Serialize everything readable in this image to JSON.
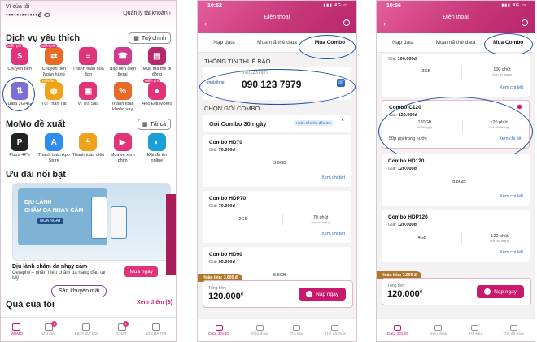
{
  "phone1": {
    "wallet_label": "Ví của tôi",
    "wallet_value": "••••••••••••đ",
    "manage_account": "Quản lý tài khoản",
    "services_title": "Dịch vụ yêu thích",
    "customize_btn": "Tuỳ chỉnh",
    "services": [
      {
        "label": "Chuyển tiền",
        "tag": "Miễn phí",
        "color": "#e0337a",
        "icon": "dollar-icon"
      },
      {
        "label": "Chuyển tiền Ngân hàng",
        "tag": "Miễn phí",
        "color": "#e86a26",
        "icon": "bank-icon"
      },
      {
        "label": "Thanh toán hóa đơn",
        "tag": "",
        "color": "#e0337a",
        "icon": "bill-icon"
      },
      {
        "label": "Nạp tiền điện thoại",
        "tag": "",
        "color": "#d03a8c",
        "icon": "phone-icon"
      },
      {
        "label": "Mua mã thẻ di động",
        "tag": "",
        "color": "#b8276c",
        "icon": "card-icon"
      },
      {
        "label": "Data 3G/4G",
        "tag": "",
        "color": "#7b6fd6",
        "icon": "data-icon"
      },
      {
        "label": "Túi Thần Tài",
        "tag": "2%/năm",
        "color": "#f0a31a",
        "icon": "bag-icon"
      },
      {
        "label": "Ví Trả Sau",
        "tag": "",
        "color": "#e0337a",
        "icon": "wallet-icon"
      },
      {
        "label": "Thanh toán khoản vay",
        "tag": "",
        "color": "#e86a26",
        "icon": "loan-icon"
      },
      {
        "label": "Heo Đất MoMo",
        "tag": "Miễn phí",
        "color": "#e0337a",
        "icon": "pig-icon"
      }
    ],
    "momo_suggest_title": "MoMo đề xuất",
    "see_all_btn": "Tất cả",
    "suggestions": [
      {
        "label": "Pizza 4P's",
        "color": "#222",
        "icon": "pizza-icon"
      },
      {
        "label": "Thanh toán App Store",
        "color": "#2d8cf0",
        "icon": "appstore-icon"
      },
      {
        "label": "Thanh toán điện",
        "color": "#f0a31a",
        "icon": "electric-icon"
      },
      {
        "label": "Mua vé xem phim",
        "color": "#e0337a",
        "icon": "ticket-icon"
      },
      {
        "label": "Đặt đồ ăn online",
        "color": "#1aa0d8",
        "icon": "food-icon"
      }
    ],
    "deals_title": "Ưu đãi nổi bật",
    "banner_line1": "DỊU LÀNH",
    "banner_line2": "CHĂM DA NHẠY CẢM",
    "banner_cta": "MUA NGAY",
    "deal_title": "Dịu lành chăm da nhạy cảm",
    "deal_sub": "Cetaphil – nhãn hiệu chăm da hàng đầu tại Mỹ",
    "buy_now": "Mua ngay",
    "promo_store": "Săn khuyến mãi",
    "gifts_title": "Quà của tôi",
    "see_more": "Xem thêm (8)",
    "nav": [
      {
        "label": "MOMO",
        "badge": ""
      },
      {
        "label": "ƯU ĐÃI",
        "badge": "8"
      },
      {
        "label": "LỊCH SỬ GD",
        "badge": ""
      },
      {
        "label": "CHAT",
        "badge": "1"
      },
      {
        "label": "VÍ CỦA TÔI",
        "badge": ""
      }
    ]
  },
  "phone2": {
    "time": "10:52",
    "signal": "4G",
    "title": "Điện thoại",
    "tabs": [
      "Nạp data",
      "Mua mã thẻ data",
      "Mua Combo"
    ],
    "subscriber_label": "THÔNG TIN THUÊ BAO",
    "carrier": "mobifone",
    "phone_small": "0901237979",
    "phone_big": "090 123 7979",
    "choose_label": "CHỌN GÓI COMBO",
    "group_name": "Gói Combo 30 ngày",
    "group_badge": "Hoàn tiền lên đến 3%",
    "combos": [
      {
        "name": "Combo HD70",
        "price_label": "Giá:",
        "price": "70.000đ",
        "data": "3.8GB",
        "minutes": "",
        "minutes_sub": ""
      },
      {
        "name": "Combo HDP70",
        "price_label": "Giá:",
        "price": "70.000đ",
        "data": "2GB",
        "minutes": "70 phút",
        "minutes_sub": "Gọi nội mạng"
      },
      {
        "name": "Combo HD90",
        "price_label": "Giá:",
        "price": "90.000đ",
        "data": "5.5GB",
        "minutes": "",
        "minutes_sub": ""
      }
    ],
    "see_detail": "Xem chi tiết",
    "cashback": "Hoàn tiền: 3.600 đ",
    "total_label": "Tổng tiền:",
    "total_value": "120.000",
    "currency": "đ",
    "pay_btn": "Nạp ngay",
    "bottom_tabs": [
      "Data 3G/4G",
      "Điện thoại",
      "Trả sau",
      "Thẻ đã mua"
    ]
  },
  "phone3": {
    "time": "10:56",
    "signal": "4G",
    "title": "Điện thoại",
    "tabs": [
      "Nạp data",
      "Mua mã thẻ data",
      "Mua Combo"
    ],
    "top_price_label": "Giá:",
    "top_price": "100.000đ",
    "top_data": "3GB",
    "top_minutes": "100 phút",
    "top_minutes_sub": "Gọi nội mạng",
    "selected": {
      "name": "Combo C120",
      "price_label": "Giá:",
      "price": "120.000đ",
      "data": "120GB",
      "data_sub": "4GB/ngày",
      "minutes": "<20 phút",
      "minutes_sub": "Gọi nội mạng",
      "extra": "50p gọi trong nước"
    },
    "combos": [
      {
        "name": "Combo HD120",
        "price_label": "Giá:",
        "price": "120.000đ",
        "data": "8.8GB",
        "minutes": "",
        "minutes_sub": ""
      },
      {
        "name": "Combo HDP120",
        "price_label": "Giá:",
        "price": "120.000đ",
        "data": "4GB",
        "minutes": "120 phút",
        "minutes_sub": "Gọi nội mạng"
      }
    ],
    "see_detail": "Xem chi tiết",
    "cashback": "Hoàn tiền: 3.600 đ",
    "total_label": "Tổng tiền:",
    "total_value": "120.000",
    "currency": "đ",
    "pay_btn": "Nạp ngay",
    "bottom_tabs": [
      "Data 3G/4G",
      "Điện thoại",
      "Trả sau",
      "Thẻ đã mua"
    ]
  },
  "colors": {
    "brand": "#c8196e",
    "highlight_circle": "#1f4fa8",
    "cashback": "#b1772b"
  }
}
